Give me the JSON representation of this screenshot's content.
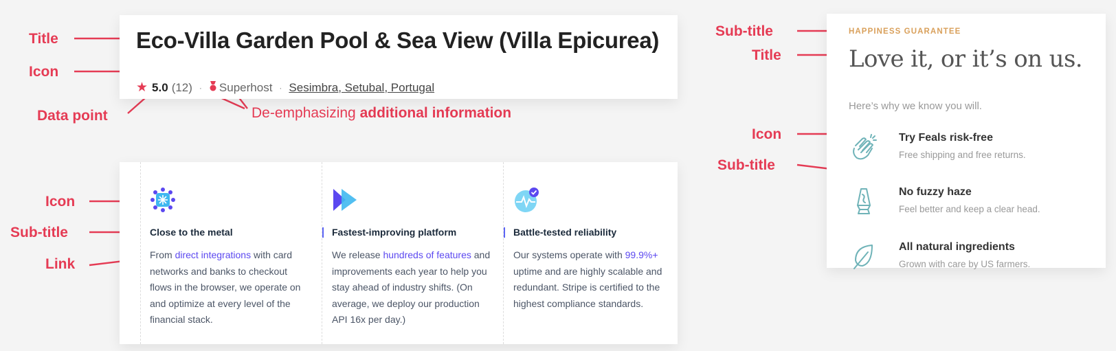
{
  "listing": {
    "title": "Eco-Villa Garden Pool & Sea View (Villa Epicurea)",
    "rating": "5.0",
    "review_count": "(12)",
    "superhost_label": "Superhost",
    "location": "Sesimbra, Setubal, Portugal",
    "icons": [
      "star-icon",
      "medal-icon"
    ]
  },
  "features": [
    {
      "icon": "snowflake-icon",
      "heading": "Close to the metal",
      "before": "From ",
      "link": "direct integrations",
      "after": " with card networks and banks to checkout flows in the browser, we operate on and optimize at every level of the financial stack."
    },
    {
      "icon": "fast-forward-icon",
      "heading": "Fastest-improving platform",
      "before": "We release ",
      "link": "hundreds of features",
      "after": " and improvements each year to help you stay ahead of industry shifts. (On average, we deploy our production API 16x per day.)"
    },
    {
      "icon": "heartbeat-check-icon",
      "heading": "Battle-tested reliability",
      "before": "Our systems operate with ",
      "link": "99.9%+",
      "after": " uptime and are highly scalable and redundant. Stripe is certified to the highest compliance standards."
    }
  ],
  "guarantee": {
    "kicker": "HAPPINESS GUARANTEE",
    "title": "Love it, or it’s on us.",
    "lead": "Here’s why we know you will.",
    "items": [
      {
        "icon": "clapping-hands-icon",
        "heading": "Try Feals risk-free",
        "sub": "Free shipping and free returns."
      },
      {
        "icon": "lava-lamp-icon",
        "heading": "No fuzzy haze",
        "sub": "Feel better and keep a clear head."
      },
      {
        "icon": "leaf-icon",
        "heading": "All natural ingredients",
        "sub": "Grown with care by US farmers."
      }
    ]
  },
  "annotations": {
    "title": "Title",
    "icon": "Icon",
    "data_point": "Data point",
    "link": "Link",
    "deemph_prefix": "De-emphasizing ",
    "deemph_bold": "additional information",
    "sub_title": "Sub-title"
  },
  "colors": {
    "annotation": "#e53b54",
    "link_accent": "#5b48f0",
    "kicker": "#d9a05b",
    "icon_teal": "#6fb3b8"
  }
}
